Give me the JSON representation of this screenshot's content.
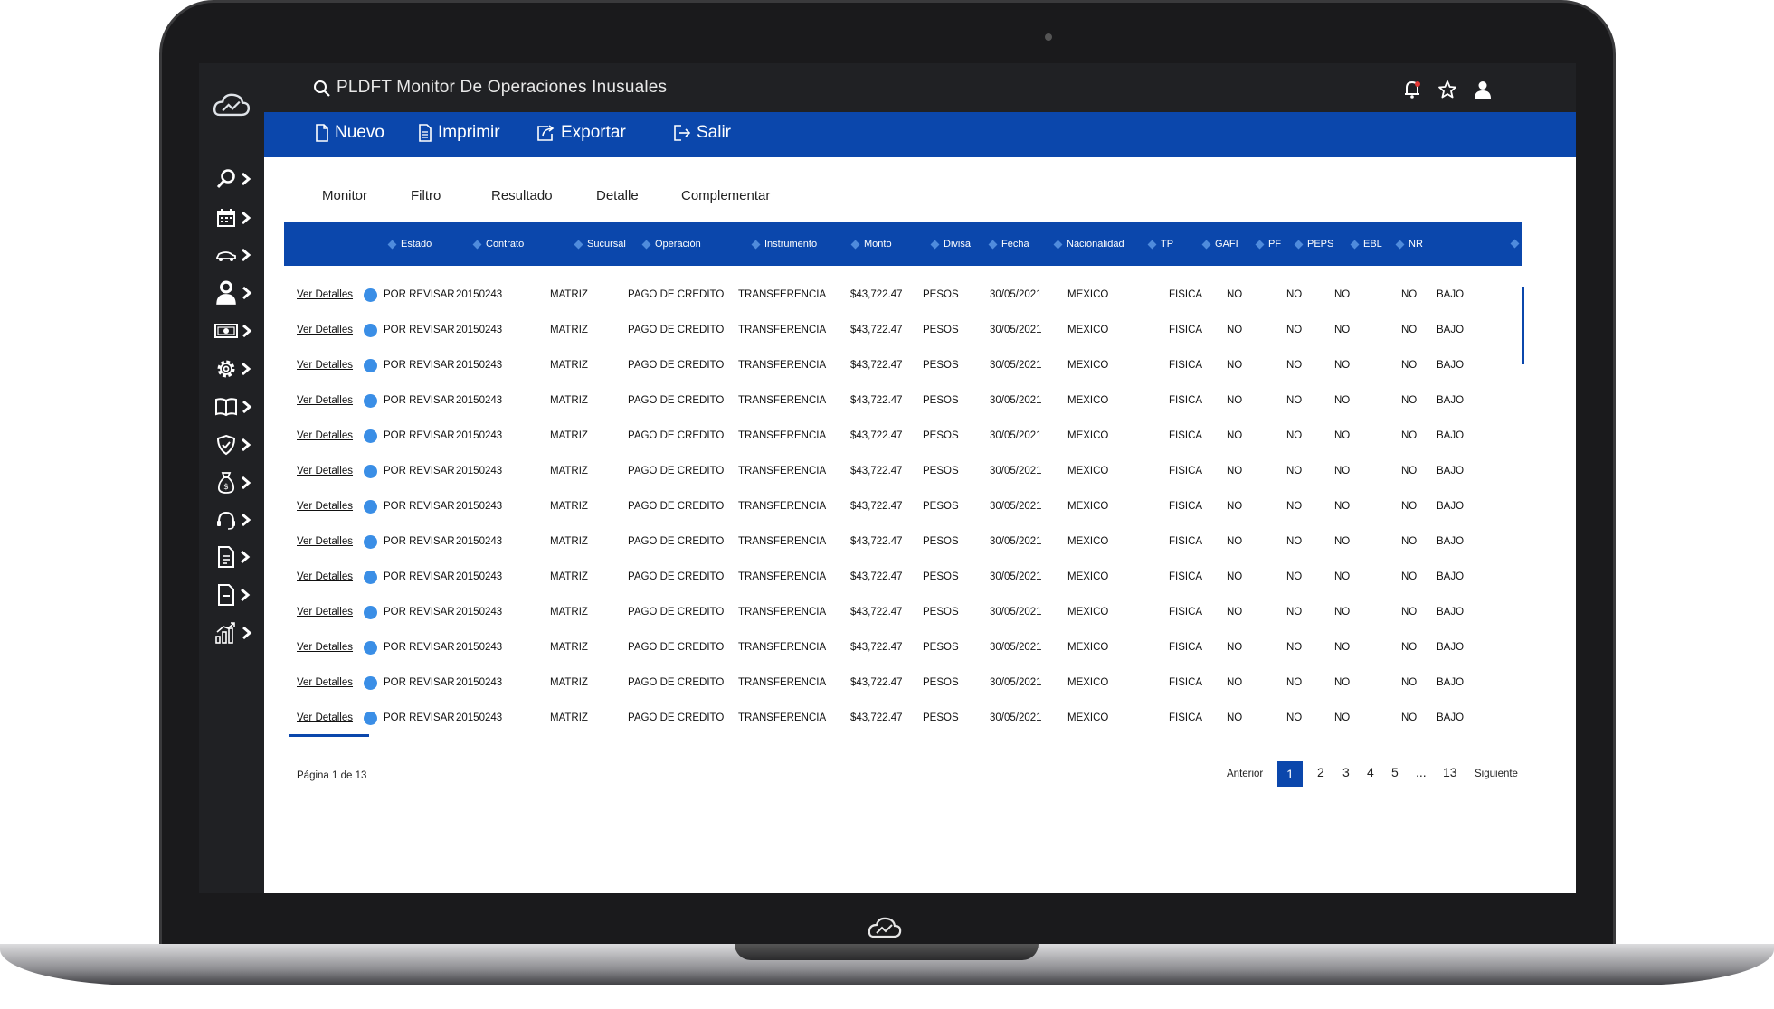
{
  "app": {
    "title": "PLDFT Monitor De Operaciones Inusuales"
  },
  "colors": {
    "brand_blue": "#0b47ac",
    "sidebar_dark": "#202124",
    "status_dot": "#3a8ee6"
  },
  "sidebar": {
    "items": [
      {
        "icon": "search-icon"
      },
      {
        "icon": "calendar-icon"
      },
      {
        "icon": "car-icon"
      },
      {
        "icon": "user-icon"
      },
      {
        "icon": "money-icon"
      },
      {
        "icon": "gear-icon"
      },
      {
        "icon": "book-icon"
      },
      {
        "icon": "shield-icon"
      },
      {
        "icon": "money-bag-icon"
      },
      {
        "icon": "headset-icon"
      },
      {
        "icon": "document-icon"
      },
      {
        "icon": "file-icon"
      },
      {
        "icon": "chart-icon"
      }
    ]
  },
  "toolbar": {
    "nuevo": "Nuevo",
    "imprimir": "Imprimir",
    "exportar": "Exportar",
    "salir": "Salir"
  },
  "tabs": [
    "Monitor",
    "Filtro",
    "Resultado",
    "Detalle",
    "Complementar"
  ],
  "table": {
    "headers": [
      "Estado",
      "Contrato",
      "Sucursal",
      "Operación",
      "Instrumento",
      "Monto",
      "Divisa",
      "Fecha",
      "Nacionalidad",
      "TP",
      "GAFI",
      "PF",
      "PEPS",
      "EBL",
      "NR"
    ],
    "rows": [
      [
        "Ver Detalles",
        "POR REVISAR",
        "20150243",
        "MATRIZ",
        "PAGO DE CREDITO",
        "TRANSFERENCIA",
        "$43,722.47",
        "PESOS",
        "30/05/2021",
        "MEXICO",
        "FISICA",
        "NO",
        "NO",
        "NO",
        "NO",
        "BAJO"
      ],
      [
        "Ver Detalles",
        "POR REVISAR",
        "20150243",
        "MATRIZ",
        "PAGO DE CREDITO",
        "TRANSFERENCIA",
        "$43,722.47",
        "PESOS",
        "30/05/2021",
        "MEXICO",
        "FISICA",
        "NO",
        "NO",
        "NO",
        "NO",
        "BAJO"
      ],
      [
        "Ver Detalles",
        "POR REVISAR",
        "20150243",
        "MATRIZ",
        "PAGO DE CREDITO",
        "TRANSFERENCIA",
        "$43,722.47",
        "PESOS",
        "30/05/2021",
        "MEXICO",
        "FISICA",
        "NO",
        "NO",
        "NO",
        "NO",
        "BAJO"
      ],
      [
        "Ver Detalles",
        "POR REVISAR",
        "20150243",
        "MATRIZ",
        "PAGO DE CREDITO",
        "TRANSFERENCIA",
        "$43,722.47",
        "PESOS",
        "30/05/2021",
        "MEXICO",
        "FISICA",
        "NO",
        "NO",
        "NO",
        "NO",
        "BAJO"
      ],
      [
        "Ver Detalles",
        "POR REVISAR",
        "20150243",
        "MATRIZ",
        "PAGO DE CREDITO",
        "TRANSFERENCIA",
        "$43,722.47",
        "PESOS",
        "30/05/2021",
        "MEXICO",
        "FISICA",
        "NO",
        "NO",
        "NO",
        "NO",
        "BAJO"
      ],
      [
        "Ver Detalles",
        "POR REVISAR",
        "20150243",
        "MATRIZ",
        "PAGO DE CREDITO",
        "TRANSFERENCIA",
        "$43,722.47",
        "PESOS",
        "30/05/2021",
        "MEXICO",
        "FISICA",
        "NO",
        "NO",
        "NO",
        "NO",
        "BAJO"
      ],
      [
        "Ver Detalles",
        "POR REVISAR",
        "20150243",
        "MATRIZ",
        "PAGO DE CREDITO",
        "TRANSFERENCIA",
        "$43,722.47",
        "PESOS",
        "30/05/2021",
        "MEXICO",
        "FISICA",
        "NO",
        "NO",
        "NO",
        "NO",
        "BAJO"
      ],
      [
        "Ver Detalles",
        "POR REVISAR",
        "20150243",
        "MATRIZ",
        "PAGO DE CREDITO",
        "TRANSFERENCIA",
        "$43,722.47",
        "PESOS",
        "30/05/2021",
        "MEXICO",
        "FISICA",
        "NO",
        "NO",
        "NO",
        "NO",
        "BAJO"
      ],
      [
        "Ver Detalles",
        "POR REVISAR",
        "20150243",
        "MATRIZ",
        "PAGO DE CREDITO",
        "TRANSFERENCIA",
        "$43,722.47",
        "PESOS",
        "30/05/2021",
        "MEXICO",
        "FISICA",
        "NO",
        "NO",
        "NO",
        "NO",
        "BAJO"
      ],
      [
        "Ver Detalles",
        "POR REVISAR",
        "20150243",
        "MATRIZ",
        "PAGO DE CREDITO",
        "TRANSFERENCIA",
        "$43,722.47",
        "PESOS",
        "30/05/2021",
        "MEXICO",
        "FISICA",
        "NO",
        "NO",
        "NO",
        "NO",
        "BAJO"
      ],
      [
        "Ver Detalles",
        "POR REVISAR",
        "20150243",
        "MATRIZ",
        "PAGO DE CREDITO",
        "TRANSFERENCIA",
        "$43,722.47",
        "PESOS",
        "30/05/2021",
        "MEXICO",
        "FISICA",
        "NO",
        "NO",
        "NO",
        "NO",
        "BAJO"
      ],
      [
        "Ver Detalles",
        "POR REVISAR",
        "20150243",
        "MATRIZ",
        "PAGO DE CREDITO",
        "TRANSFERENCIA",
        "$43,722.47",
        "PESOS",
        "30/05/2021",
        "MEXICO",
        "FISICA",
        "NO",
        "NO",
        "NO",
        "NO",
        "BAJO"
      ],
      [
        "Ver Detalles",
        "POR REVISAR",
        "20150243",
        "MATRIZ",
        "PAGO DE CREDITO",
        "TRANSFERENCIA",
        "$43,722.47",
        "PESOS",
        "30/05/2021",
        "MEXICO",
        "FISICA",
        "NO",
        "NO",
        "NO",
        "NO",
        "BAJO"
      ]
    ]
  },
  "pagination": {
    "info": "Página 1 de 13",
    "prev": "Anterior",
    "pages": [
      "1",
      "2",
      "3",
      "4",
      "5",
      "...",
      "13"
    ],
    "current": "1",
    "next": "Siguiente"
  }
}
